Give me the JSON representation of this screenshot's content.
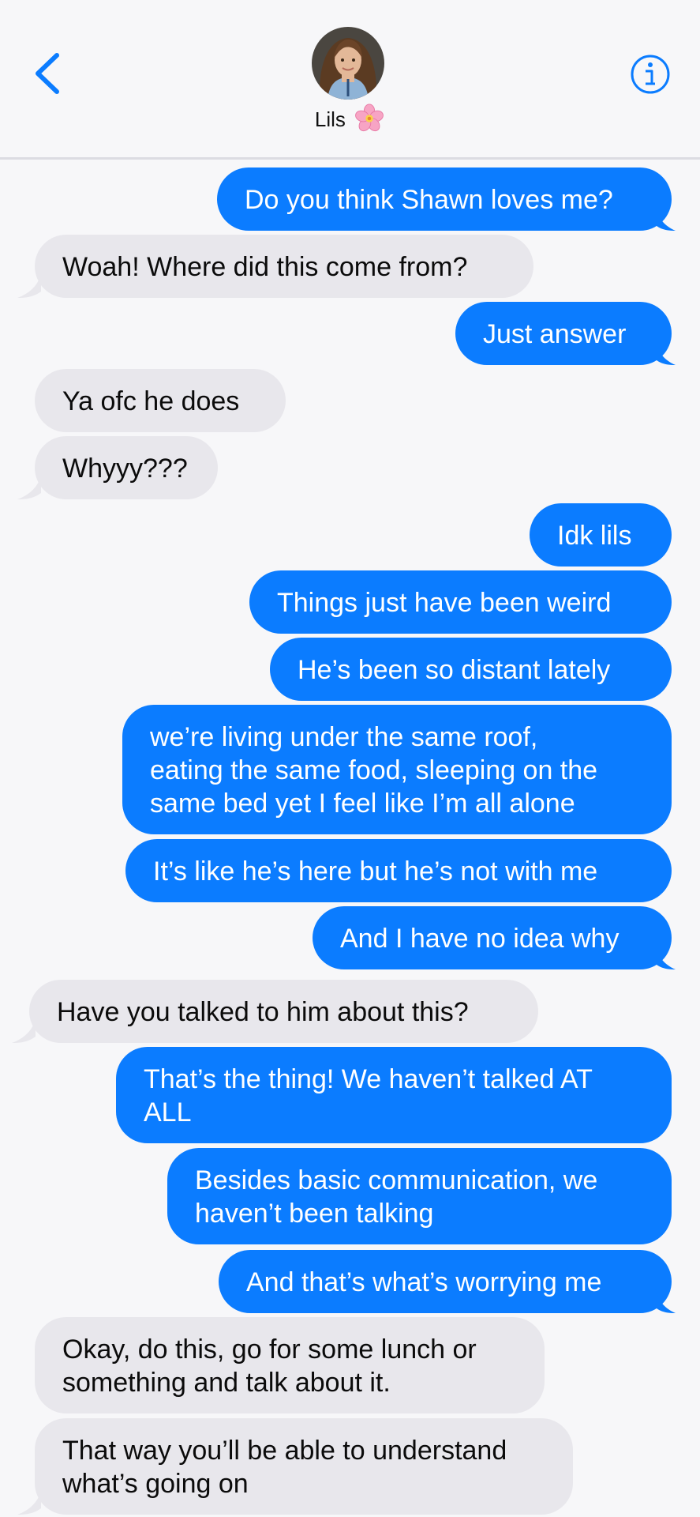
{
  "header": {
    "contact_name": "Lils",
    "back_icon": "chevron-left-icon",
    "info_icon": "info-icon",
    "accent_color": "#0b7cff"
  },
  "messages": [
    {
      "dir": "out",
      "text": "Do you think Shawn loves me?"
    },
    {
      "dir": "in",
      "text": "Woah! Where did this come from?"
    },
    {
      "dir": "out",
      "text": "Just answer"
    },
    {
      "dir": "in",
      "text": "Ya ofc he does"
    },
    {
      "dir": "in",
      "text": "Whyyy???"
    },
    {
      "dir": "out",
      "text": "Idk lils"
    },
    {
      "dir": "out",
      "text": "Things just have been weird"
    },
    {
      "dir": "out",
      "text": "He’s been so distant lately"
    },
    {
      "dir": "out",
      "text": "we’re living under the same roof,\neating the same food, sleeping on the\nsame bed yet I feel like I’m all alone"
    },
    {
      "dir": "out",
      "text": "It’s like he’s here but he’s not with me"
    },
    {
      "dir": "out",
      "text": "And I have no idea why"
    },
    {
      "dir": "in",
      "text": "Have you talked to him about this?"
    },
    {
      "dir": "out",
      "text": "That’s the thing! We haven’t talked AT\nALL"
    },
    {
      "dir": "out",
      "text": "Besides basic communication, we\nhaven’t been talking"
    },
    {
      "dir": "out",
      "text": "And that’s what’s worrying me"
    },
    {
      "dir": "in",
      "text": "Okay, do this, go for some lunch or\nsomething and talk about it."
    },
    {
      "dir": "in",
      "text": "That way you’ll be able to understand\nwhat’s going on"
    }
  ]
}
